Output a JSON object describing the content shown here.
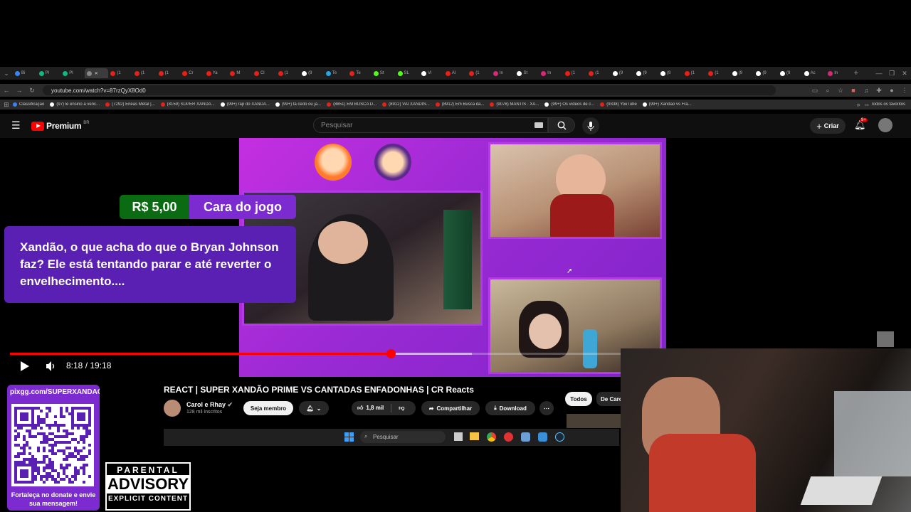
{
  "browser": {
    "tabs": [
      {
        "label": "Bi",
        "color": "#3b82f6"
      },
      {
        "label": "Pl",
        "color": "#10b981"
      },
      {
        "label": "Pl",
        "color": "#10b981"
      },
      {
        "label": "",
        "color": "#888888",
        "active": true
      },
      {
        "label": "(1",
        "color": "#e62117"
      },
      {
        "label": "(1",
        "color": "#e62117"
      },
      {
        "label": "(1",
        "color": "#e62117"
      },
      {
        "label": "Cr",
        "color": "#e62117"
      },
      {
        "label": "Ya",
        "color": "#e62117"
      },
      {
        "label": "M",
        "color": "#e62117"
      },
      {
        "label": "Cl",
        "color": "#e62117"
      },
      {
        "label": "(1",
        "color": "#e62117"
      },
      {
        "label": "(9",
        "color": "#ffffff"
      },
      {
        "label": "Te",
        "color": "#2aa3e0"
      },
      {
        "label": "Te",
        "color": "#e62117"
      },
      {
        "label": "St",
        "color": "#53fc18"
      },
      {
        "label": "SL",
        "color": "#53fc18"
      },
      {
        "label": "Vi",
        "color": "#ffffff"
      },
      {
        "label": "Al",
        "color": "#e62117"
      },
      {
        "label": "(1",
        "color": "#e62117"
      },
      {
        "label": "In",
        "color": "#d62976"
      },
      {
        "label": "St",
        "color": "#ffffff"
      },
      {
        "label": "In",
        "color": "#d62976"
      },
      {
        "label": "(1",
        "color": "#e62117"
      },
      {
        "label": "(1",
        "color": "#e62117"
      },
      {
        "label": "(9",
        "color": "#ffffff"
      },
      {
        "label": "(9",
        "color": "#ffffff"
      },
      {
        "label": "(9",
        "color": "#ffffff"
      },
      {
        "label": "(1",
        "color": "#e62117"
      },
      {
        "label": "(1",
        "color": "#e62117"
      },
      {
        "label": "(9",
        "color": "#ffffff"
      },
      {
        "label": "(9",
        "color": "#ffffff"
      },
      {
        "label": "(9",
        "color": "#ffffff"
      },
      {
        "label": "Ac",
        "color": "#ffffff"
      },
      {
        "label": "In",
        "color": "#d62976"
      }
    ],
    "url": "youtube.com/watch?v=87rzQyX8Od0",
    "bookmarks": [
      {
        "label": "Classificação",
        "icon": "#3b82f6"
      },
      {
        "label": "(97) le ensino a venc...",
        "icon": "#ffffff"
      },
      {
        "label": "(7292) Enéas Metal |...",
        "icon": "#e62117"
      },
      {
        "label": "(8159) SUPER XANDÃ...",
        "icon": "#e62117"
      },
      {
        "label": "(99+) rap do XANDÃ...",
        "icon": "#ffffff"
      },
      {
        "label": "(99+) tá cedo ou já...",
        "icon": "#ffffff"
      },
      {
        "label": "(8851) EM BUSCA D...",
        "icon": "#e62117"
      },
      {
        "label": "(8912) VAI XANDIN...",
        "icon": "#e62117"
      },
      {
        "label": "(8912) Em Busca da...",
        "icon": "#e62117"
      },
      {
        "label": "(9078) MANTIS · XA...",
        "icon": "#e62117"
      },
      {
        "label": "(99+) Os vídeos de c...",
        "icon": "#ffffff"
      },
      {
        "label": "(9338) YouTube",
        "icon": "#e62117"
      },
      {
        "label": "(99+) Xandão vs Fra...",
        "icon": "#ffffff"
      }
    ],
    "all_bookmarks": "Todos os favoritos"
  },
  "youtube": {
    "logo": "Premium",
    "region": "BR",
    "search_placeholder": "Pesquisar",
    "create": "Criar",
    "notif_count": "9+"
  },
  "video": {
    "price": "R$ 5,00",
    "game": "Cara do jogo",
    "message": "Xandão, o que acha do que o Bryan Johnson faz? Ele está tentando parar e até reverter o envelhecimento....",
    "time": "8:18 / 19:18",
    "progress_fraction": 0.427
  },
  "meta": {
    "title": "REACT | SUPER XANDÃO PRIME VS CANTADAS ENFADONHAS | CR Reacts",
    "channel": "Carol e Rhay",
    "subs": "128 mil inscritos",
    "member": "Seja membro",
    "likes": "1,8 mil",
    "share": "Compartilhar",
    "download": "Download",
    "chip_all": "Todos",
    "chip_from": "De Caro"
  },
  "taskbar": {
    "search": "Pesquisar"
  },
  "overlay": {
    "qr_url": "pixgg.com/SUPERXANDAO",
    "qr_footer": "Fortaleça no donate e envie sua mensagem!",
    "advisory_top": "PARENTAL",
    "advisory_mid": "ADVISORY",
    "advisory_bottom": "EXPLICIT CONTENT"
  }
}
